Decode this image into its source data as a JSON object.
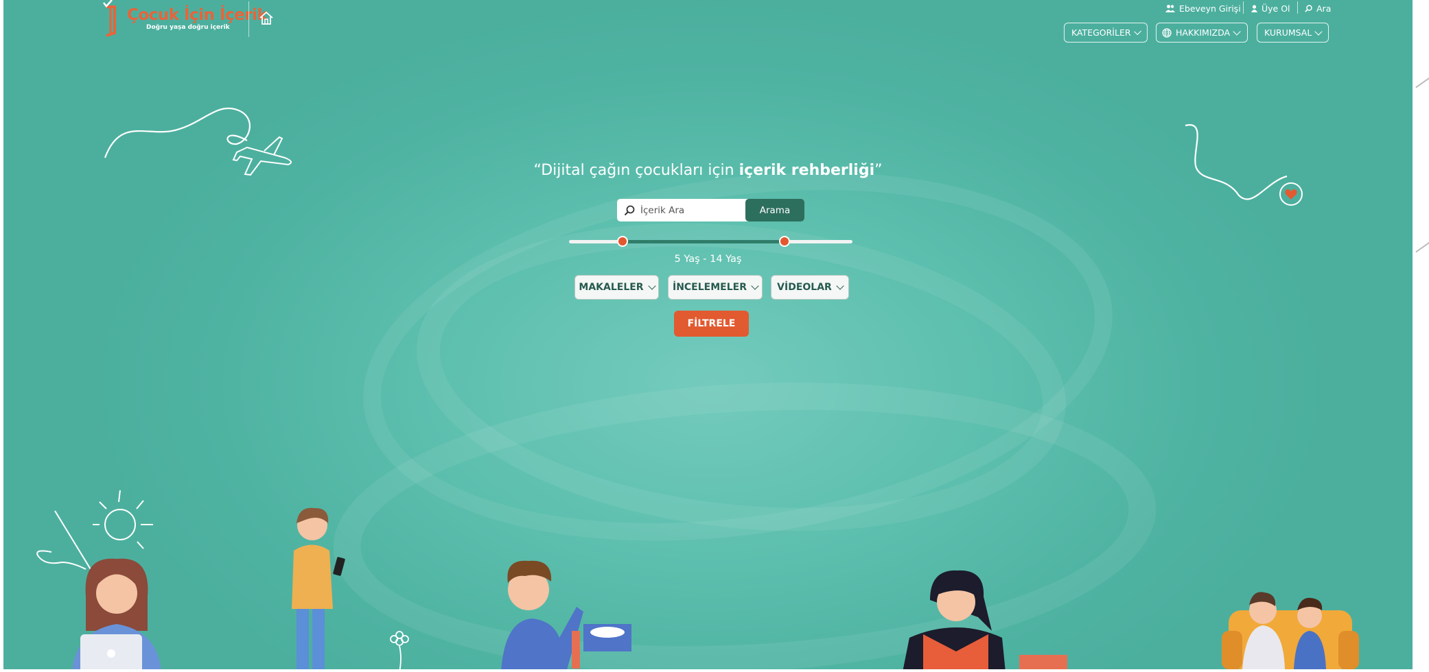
{
  "brand": {
    "title": "Çocuk İçin İçerik",
    "subtitle": "Doğru yaşa doğru içerik"
  },
  "toplinks": [
    {
      "label": "Ebeveyn Girişi",
      "icon": "users-icon"
    },
    {
      "label": "Üye Ol",
      "icon": "user-icon"
    },
    {
      "label": "Ara",
      "icon": "search-icon"
    }
  ],
  "nav": [
    {
      "label": "KATEGORİLER"
    },
    {
      "label": "HAKKIMIZDA",
      "icon": "globe-icon"
    },
    {
      "label": "KURUMSAL"
    }
  ],
  "hero": {
    "quote_open": "“Dijital çağın çocukları için ",
    "quote_bold": "içerik rehberliği",
    "quote_close": "”"
  },
  "search": {
    "placeholder": "İçerik Ara",
    "value": "",
    "button": "Arama"
  },
  "age_slider": {
    "min_value": 5,
    "max_value": 14,
    "lower_fraction": 0.19,
    "upper_fraction": 0.76,
    "label": "5 Yaş - 14 Yaş"
  },
  "filters": [
    {
      "label": "MAKALELER"
    },
    {
      "label": "İNCELEMELER"
    },
    {
      "label": "VİDEOLAR"
    }
  ],
  "filter_button": "FİLTRELE",
  "colors": {
    "background": "#4fb3a2",
    "accent": "#e25a30",
    "dark_green": "#2d6f5d"
  }
}
